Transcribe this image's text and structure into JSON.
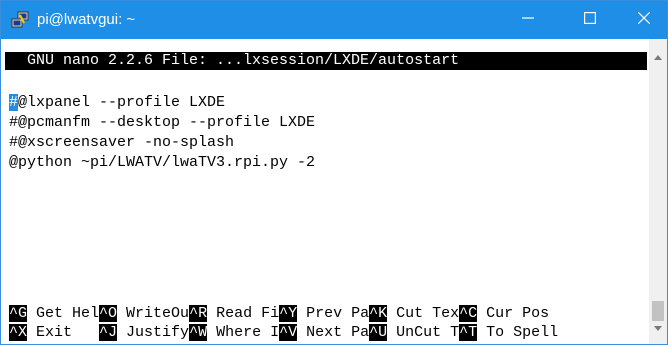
{
  "window": {
    "title": "pi@lwatvgui: ~",
    "icon": "putty-icon",
    "accent_color": "#1e8ee6",
    "controls": {
      "minimize_icon": "minimize-icon",
      "maximize_icon": "maximize-icon",
      "close_icon": "close-icon"
    }
  },
  "nano": {
    "header": "  GNU nano 2.2.6 File: ...lxsession/LXDE/autostart",
    "lines": [
      {
        "cursor_char": "#",
        "rest": "@lxpanel --profile LXDE"
      },
      {
        "text": "#@pcmanfm --desktop --profile LXDE"
      },
      {
        "text": "#@xscreensaver -no-splash"
      },
      {
        "text": "@python ~pi/LWATV/lwaTV3.rpi.py -2"
      }
    ],
    "shortcuts_row1": [
      {
        "key": "^G",
        "label": " Get Hel"
      },
      {
        "key": "^O",
        "label": " WriteOu"
      },
      {
        "key": "^R",
        "label": " Read Fi"
      },
      {
        "key": "^Y",
        "label": " Prev Pa"
      },
      {
        "key": "^K",
        "label": " Cut Tex"
      },
      {
        "key": "^C",
        "label": " Cur Pos"
      }
    ],
    "shortcuts_row2": [
      {
        "key": "^X",
        "label": " Exit   "
      },
      {
        "key": "^J",
        "label": " Justify"
      },
      {
        "key": "^W",
        "label": " Where I"
      },
      {
        "key": "^V",
        "label": " Next Pa"
      },
      {
        "key": "^U",
        "label": " UnCut T"
      },
      {
        "key": "^T",
        "label": " To Spell"
      }
    ]
  }
}
